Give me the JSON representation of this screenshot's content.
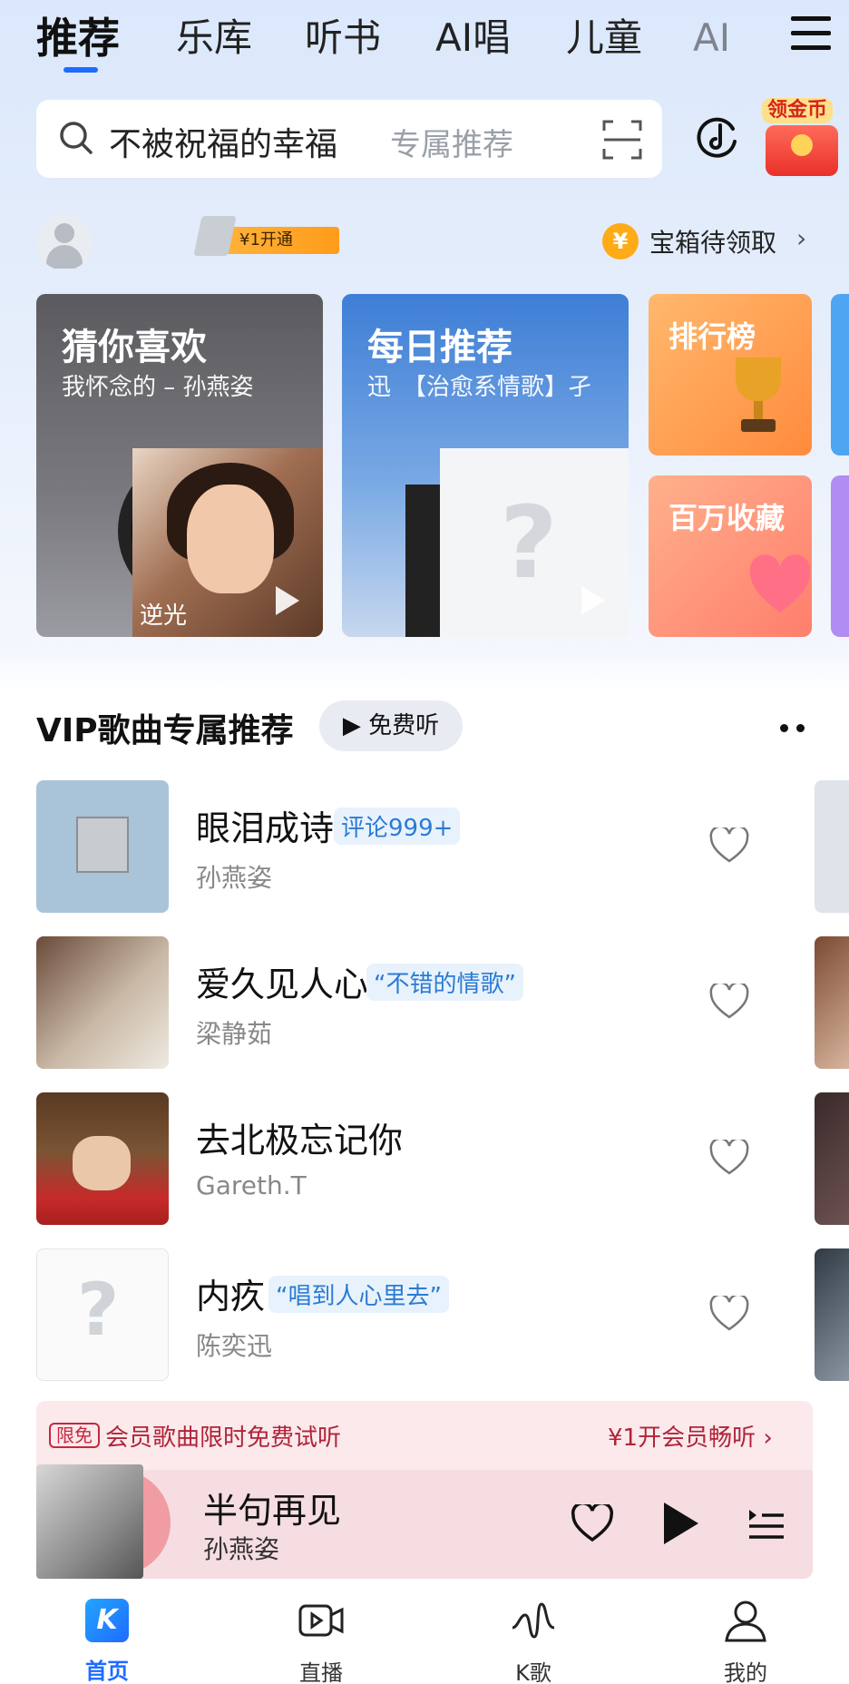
{
  "top_tabs": [
    "推荐",
    "乐库",
    "听书",
    "AI唱",
    "儿童",
    "AI"
  ],
  "search": {
    "query": "不被祝福的幸福",
    "hint": "专属推荐"
  },
  "gold_coin_label": "领金币",
  "vip_badge": "¥1开通",
  "treasure": {
    "coin": "¥",
    "text": "宝箱待领取"
  },
  "cards": {
    "guess": {
      "title": "猜你喜欢",
      "subtitle": "我怀念的 – 孙燕姿",
      "cover_text": "逆光"
    },
    "daily": {
      "title": "每日推荐",
      "subtitle": "迅　【治愈系情歌】孑"
    },
    "rank": {
      "title": "排行榜"
    },
    "collect": {
      "title": "百万收藏"
    }
  },
  "section": {
    "title": "VIP歌曲专属推荐",
    "free_button": "▶ 免费听"
  },
  "songs": [
    {
      "name": "眼泪成诗",
      "tag": "评论999+",
      "artist": "孙燕姿"
    },
    {
      "name": "爱久见人心",
      "tag": "“不错的情歌”",
      "artist": "梁静茹"
    },
    {
      "name": "去北极忘记你",
      "tag": "",
      "artist": "Gareth.T"
    },
    {
      "name": "内疚",
      "tag": "“唱到人心里去”",
      "artist": "陈奕迅"
    }
  ],
  "promo": {
    "badge": "限免",
    "text": "会员歌曲限时免费试听",
    "cta": "¥1开会员畅听 ›"
  },
  "player": {
    "title": "半句再见",
    "artist": "孙燕姿"
  },
  "bottom_nav": [
    {
      "label": "首页",
      "icon": "k-logo-icon"
    },
    {
      "label": "直播",
      "icon": "live-icon"
    },
    {
      "label": "K歌",
      "icon": "k-song-icon"
    },
    {
      "label": "我的",
      "icon": "profile-icon"
    }
  ],
  "colors": {
    "accent": "#1f6bff",
    "tag_blue": "#2b7bd4",
    "promo_red": "#b02438"
  }
}
